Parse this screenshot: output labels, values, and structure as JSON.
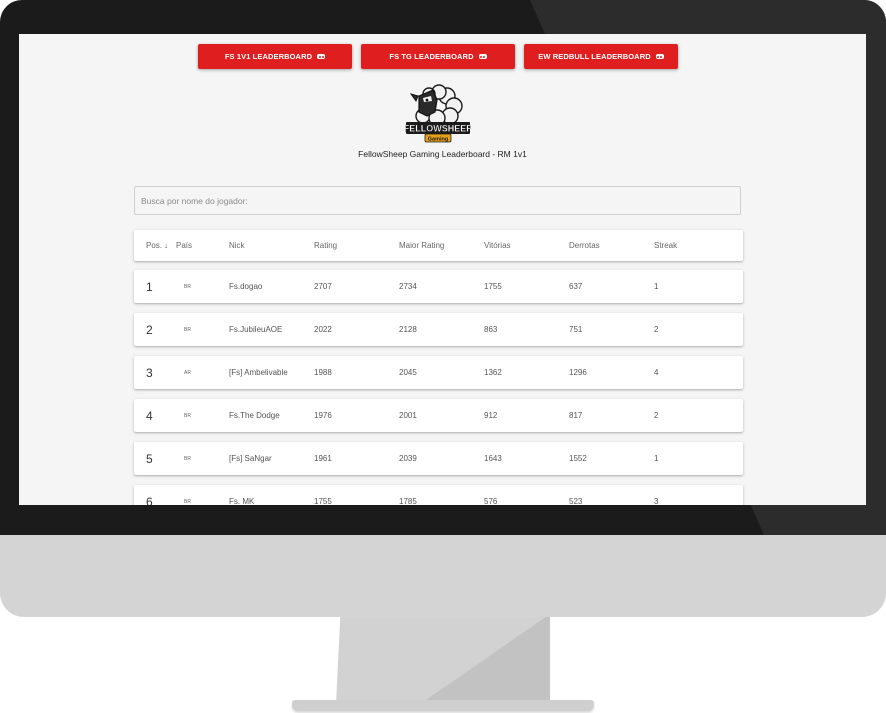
{
  "nav": {
    "buttons": [
      {
        "label": "FS 1V1 LEADERBOARD",
        "icon": "gamepad-icon"
      },
      {
        "label": "FS TG LEADERBOARD",
        "icon": "gamepad-icon"
      },
      {
        "label": "EW REDBULL LEADERBOARD",
        "icon": "gamepad-icon"
      }
    ]
  },
  "brand": {
    "logo_text": "FELLOWSHEEP",
    "logo_sub": "Gaming",
    "logo_colors": {
      "primary": "#df1f1f",
      "accent": "#e8a11a"
    }
  },
  "page_title": "FellowSheep Gaming Leaderboard - RM 1v1",
  "search": {
    "placeholder": "Busca por nome do jogador:"
  },
  "table": {
    "headers": {
      "pos": "Pos.",
      "sort_arrow": "↓",
      "country": "País",
      "nick": "Nick",
      "rating": "Rating",
      "max_rating": "Maior Rating",
      "wins": "Vitórias",
      "losses": "Derrotas",
      "streak": "Streak"
    },
    "rows": [
      {
        "pos": "1",
        "country": "BR",
        "nick": "Fs.dogao",
        "rating": "2707",
        "max_rating": "2734",
        "wins": "1755",
        "losses": "637",
        "streak": "1"
      },
      {
        "pos": "2",
        "country": "BR",
        "nick": "Fs.JubileuAOE",
        "rating": "2022",
        "max_rating": "2128",
        "wins": "863",
        "losses": "751",
        "streak": "2"
      },
      {
        "pos": "3",
        "country": "AR",
        "nick": "[Fs] Ambelivable",
        "rating": "1988",
        "max_rating": "2045",
        "wins": "1362",
        "losses": "1296",
        "streak": "4"
      },
      {
        "pos": "4",
        "country": "BR",
        "nick": "Fs.The Dodge",
        "rating": "1976",
        "max_rating": "2001",
        "wins": "912",
        "losses": "817",
        "streak": "2"
      },
      {
        "pos": "5",
        "country": "BR",
        "nick": "[Fs] SaNgar",
        "rating": "1961",
        "max_rating": "2039",
        "wins": "1643",
        "losses": "1552",
        "streak": "1"
      },
      {
        "pos": "6",
        "country": "BR",
        "nick": "Fs. MK",
        "rating": "1755",
        "max_rating": "1785",
        "wins": "576",
        "losses": "523",
        "streak": "3"
      }
    ]
  },
  "colors": {
    "accent": "#df1f1f",
    "screen_bg": "#f5f5f5",
    "bezel": "#1b1b1b",
    "chin": "#d4d4d4"
  }
}
